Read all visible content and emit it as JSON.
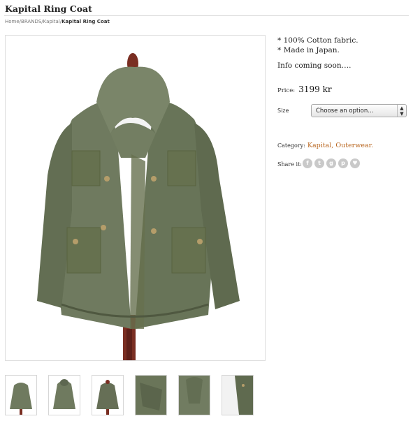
{
  "page": {
    "title": "Kapital Ring Coat"
  },
  "breadcrumb": {
    "items": [
      "Home",
      "BRANDS",
      "Kapital"
    ],
    "separator": "/",
    "current": "Kapital Ring Coat"
  },
  "product": {
    "description": [
      "* 100% Cotton fabric.",
      "* Made in Japan."
    ],
    "info_note": "Info coming soon….",
    "price_label": "Price:",
    "price": "3199 kr",
    "size_label": "Size",
    "size_select_value": "Choose an option…",
    "category_label": "Category:",
    "categories": [
      "Kapital",
      "Outerwear"
    ],
    "share_label": "Share it:",
    "share_icons": [
      "facebook-icon",
      "twitter-icon",
      "google-plus-icon",
      "pinterest-icon",
      "heart-icon"
    ],
    "link_color": "#b8651e",
    "coat_color": "#6f7a5f"
  }
}
